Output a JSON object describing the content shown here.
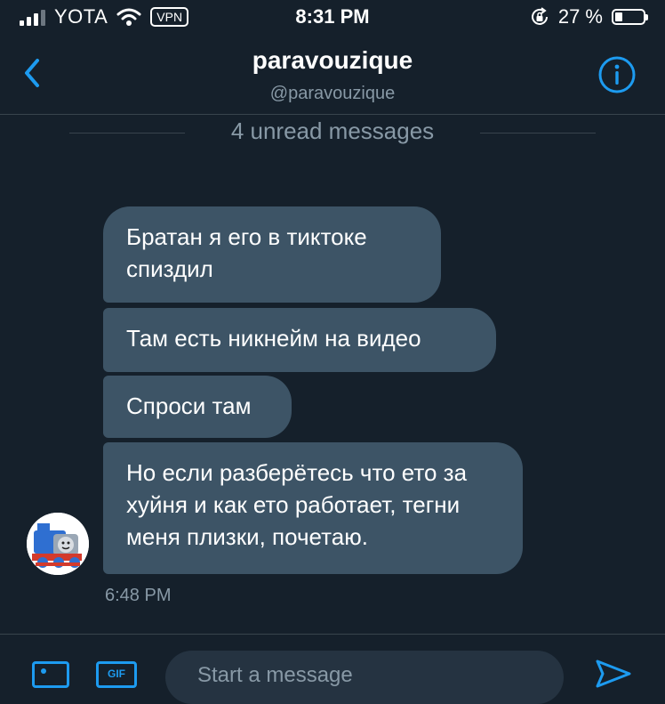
{
  "status_bar": {
    "carrier": "YOTA",
    "vpn": "VPN",
    "time": "8:31 PM",
    "battery_percent": "27 %",
    "battery_level": 0.27
  },
  "header": {
    "title": "paravouzique",
    "handle": "@paravouzique"
  },
  "divider": {
    "unread_label": "4 unread messages"
  },
  "messages": [
    {
      "text": "Братан я его в тиктоке спиздил"
    },
    {
      "text": "Там есть никнейм на видео"
    },
    {
      "text": "Спроси там"
    },
    {
      "text": "Но если разберётесь что ето за хуйня и как ето работает, тегни меня плизки, почетаю."
    }
  ],
  "message_time": "6:48 PM",
  "composer": {
    "gif_label": "GIF",
    "placeholder": "Start a message"
  },
  "colors": {
    "background": "#15202b",
    "bubble": "#3d5466",
    "accent": "#1d9bf0",
    "muted": "#8899a6"
  }
}
